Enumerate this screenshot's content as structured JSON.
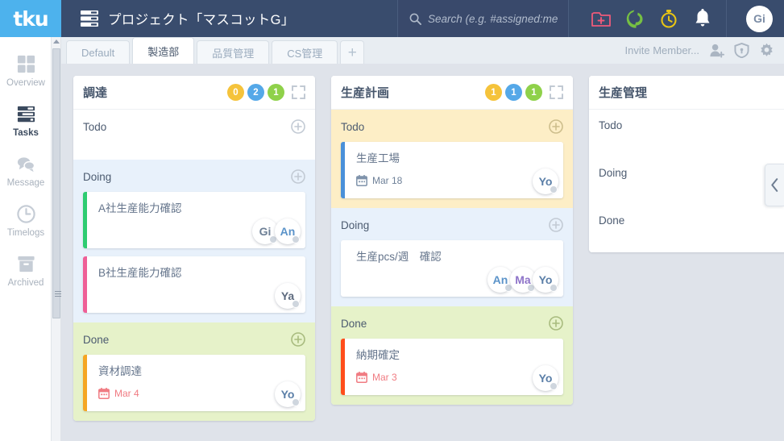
{
  "header": {
    "logo_text": "tku",
    "project_title": "プロジェクト「マスコットG」",
    "search_placeholder": "Search (e.g. #assigned:me #s",
    "search_value": "",
    "avatar_initials": "Gi",
    "icons": {
      "project_icon": "server-stack-icon",
      "search_icon": "search-icon",
      "new_project": "new-project-icon",
      "tools": "wrench-icon",
      "timer": "stopwatch-icon",
      "notifications": "bell-icon"
    },
    "colors": {
      "bar": "#394c6d",
      "logo_bg": "#4db2ed",
      "new_project": "#ef5a7a",
      "tools": "#76c043",
      "timer": "#e8c414",
      "bell": "#ffffff"
    }
  },
  "sidebar": {
    "items": [
      {
        "label": "Overview",
        "icon": "grid-icon",
        "active": false
      },
      {
        "label": "Tasks",
        "icon": "list-icon",
        "active": true
      },
      {
        "label": "Message",
        "icon": "chat-bubble-icon",
        "active": false
      },
      {
        "label": "Timelogs",
        "icon": "clock-icon",
        "active": false
      },
      {
        "label": "Archived",
        "icon": "archive-box-icon",
        "active": false
      }
    ]
  },
  "tabs": {
    "items": [
      {
        "label": "Default",
        "active": false
      },
      {
        "label": "製造部",
        "active": true
      },
      {
        "label": "品質管理",
        "active": false
      },
      {
        "label": "CS管理",
        "active": false
      }
    ],
    "add_label": "+",
    "invite_label": "Invite Member...",
    "right_icons": [
      "add-person-icon",
      "shield-icon",
      "gear-icon"
    ]
  },
  "board": {
    "collapse_handle": "‹",
    "columns": [
      {
        "title": "調達",
        "badges": [
          {
            "value": "0",
            "color": "#f5c33b"
          },
          {
            "value": "2",
            "color": "#55a8e8"
          },
          {
            "value": "1",
            "color": "#8fd14a"
          }
        ],
        "expand_icon": "expand-icon",
        "lanes": [
          {
            "title": "Todo",
            "type": "todo",
            "cards": []
          },
          {
            "title": "Doing",
            "type": "doing",
            "cards": [
              {
                "title": "A社生産能力確認",
                "accent": "#2ecc71",
                "date": null,
                "avatars": [
                  {
                    "initials": "Gi",
                    "c1": "#6d7f95",
                    "c2": "#b9c4d0"
                  },
                  {
                    "initials": "An",
                    "c1": "#5b93c9",
                    "c2": "#d8a84e"
                  }
                ]
              },
              {
                "title": "B社生産能力確認",
                "accent": "#ef5f97",
                "date": null,
                "avatars": [
                  {
                    "initials": "Ya",
                    "c1": "#5d6a7e",
                    "c2": "#d08b4a"
                  }
                ]
              }
            ]
          },
          {
            "title": "Done",
            "type": "done",
            "cards": [
              {
                "title": "資材調達",
                "accent": "#f5a623",
                "date": "Mar 4",
                "avatars": [
                  {
                    "initials": "Yo",
                    "c1": "#5b7fa8",
                    "c2": "#d8a84e"
                  }
                ]
              }
            ]
          }
        ]
      },
      {
        "title": "生産計画",
        "badges": [
          {
            "value": "1",
            "color": "#f5c33b"
          },
          {
            "value": "1",
            "color": "#55a8e8"
          },
          {
            "value": "1",
            "color": "#8fd14a"
          }
        ],
        "expand_icon": "expand-icon",
        "lanes": [
          {
            "title": "Todo",
            "type": "todo-filled",
            "cards": [
              {
                "title": "生産工場",
                "accent": "#4a90d9",
                "date": "Mar 18",
                "avatars": [
                  {
                    "initials": "Yo",
                    "c1": "#5b7fa8",
                    "c2": "#d8a84e"
                  }
                ]
              }
            ]
          },
          {
            "title": "Doing",
            "type": "doing",
            "cards": [
              {
                "title": "生産pcs/週　確認",
                "accent": "#ffffff",
                "date": null,
                "avatars": [
                  {
                    "initials": "An",
                    "c1": "#5b93c9",
                    "c2": "#86b84a"
                  },
                  {
                    "initials": "Ma",
                    "c1": "#8e74c9",
                    "c2": "#d06a8a"
                  },
                  {
                    "initials": "Yo",
                    "c1": "#5b7fa8",
                    "c2": "#d8a84e"
                  }
                ]
              }
            ]
          },
          {
            "title": "Done",
            "type": "done",
            "cards": [
              {
                "title": "納期確定",
                "accent": "#ff4d1a",
                "date": "Mar 3",
                "avatars": [
                  {
                    "initials": "Yo",
                    "c1": "#5b7fa8",
                    "c2": "#d8a84e"
                  }
                ]
              }
            ]
          }
        ]
      },
      {
        "title": "生産管理",
        "badges": [],
        "expand_icon": null,
        "lanes": [
          {
            "title": "Todo",
            "type": "plain",
            "cards": []
          },
          {
            "title": "Doing",
            "type": "plain",
            "cards": []
          },
          {
            "title": "Done",
            "type": "plain",
            "cards": []
          }
        ]
      }
    ]
  }
}
